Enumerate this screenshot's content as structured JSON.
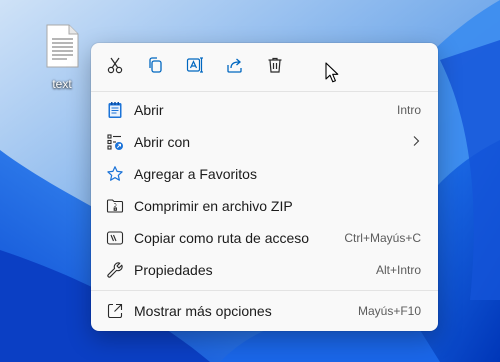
{
  "desktop": {
    "file_label": "text",
    "file_icon": "text-file-icon"
  },
  "context_menu": {
    "toolbar": [
      {
        "name": "cut-icon"
      },
      {
        "name": "copy-icon"
      },
      {
        "name": "rename-icon"
      },
      {
        "name": "share-icon"
      },
      {
        "name": "delete-icon"
      }
    ],
    "items": [
      {
        "label": "Abrir",
        "shortcut": "Intro",
        "icon": "notepad-icon"
      },
      {
        "label": "Abrir con",
        "shortcut": "",
        "icon": "open-with-icon",
        "submenu": true
      },
      {
        "label": "Agregar a Favoritos",
        "shortcut": "",
        "icon": "star-icon"
      },
      {
        "label": "Comprimir en archivo ZIP",
        "shortcut": "",
        "icon": "zip-folder-icon"
      },
      {
        "label": "Copiar como ruta de acceso",
        "shortcut": "Ctrl+Mayús+C",
        "icon": "copy-path-icon"
      },
      {
        "label": "Propiedades",
        "shortcut": "Alt+Intro",
        "icon": "wrench-icon"
      },
      {
        "label": "Mostrar más opciones",
        "shortcut": "Mayús+F10",
        "icon": "show-more-icon"
      }
    ]
  },
  "colors": {
    "accent": "#0067c0",
    "wallpaper_blue": "#0a5fd6",
    "menu_bg": "#f9f9f9"
  }
}
